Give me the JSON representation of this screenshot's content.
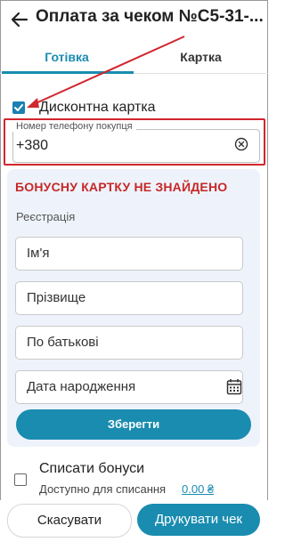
{
  "header": {
    "title": "Оплата за чеком №С5-31-..."
  },
  "tabs": [
    {
      "label": "Готівка",
      "active": true
    },
    {
      "label": "Картка",
      "active": false
    }
  ],
  "discount": {
    "checkbox_label": "Дисконтна картка",
    "checked": true
  },
  "phone": {
    "legend": "Номер телефону покупця",
    "value": "+380"
  },
  "registration": {
    "not_found": "БОНУСНУ КАРТКУ НЕ ЗНАЙДЕНО",
    "section_label": "Реєстрація",
    "first_name_placeholder": "Ім'я",
    "last_name_placeholder": "Прізвище",
    "middle_name_placeholder": "По батькові",
    "birth_date_placeholder": "Дата народження",
    "save_label": "Зберегти"
  },
  "bonus": {
    "checkbox_label": "Списати бонуси",
    "checked": false,
    "available_label": "Доступно для списання",
    "available_value": "0.00 ₴"
  },
  "footer": {
    "cancel_label": "Скасувати",
    "print_label": "Друкувати чек"
  },
  "colors": {
    "accent": "#1a8cb0",
    "error": "#c62828",
    "highlight_border": "#d0262e",
    "panel_bg": "#eef3fb"
  }
}
